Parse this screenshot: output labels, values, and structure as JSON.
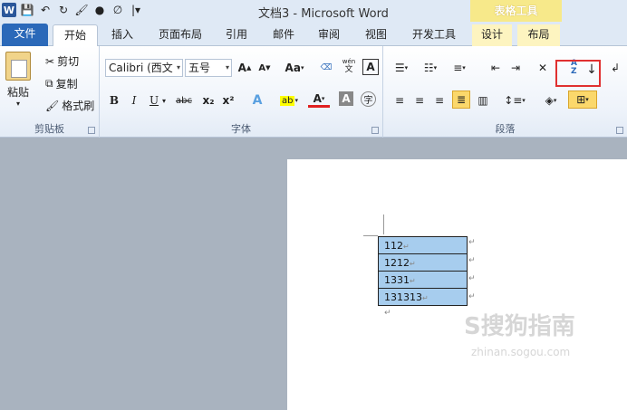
{
  "window": {
    "title": "文档3 - Microsoft Word",
    "context_tools_label": "表格工具"
  },
  "tabs": {
    "file": "文件",
    "home": "开始",
    "insert": "插入",
    "page_layout": "页面布局",
    "references": "引用",
    "mailings": "邮件",
    "review": "审阅",
    "view": "视图",
    "developer": "开发工具",
    "design": "设计",
    "layout": "布局"
  },
  "clipboard": {
    "group_label": "剪贴板",
    "paste": "粘贴",
    "cut": "剪切",
    "copy": "复制",
    "format_painter": "格式刷"
  },
  "font": {
    "group_label": "字体",
    "font_name": "Calibri (西文",
    "font_size": "五号",
    "grow": "A",
    "shrink": "A",
    "change_case": "Aa",
    "bold": "B",
    "italic": "I",
    "underline": "U",
    "strikethrough": "abc",
    "subscript": "x₂",
    "superscript": "x²",
    "font_color": "A",
    "char_shading": "A",
    "enclose": "字",
    "phonetic": "wén"
  },
  "paragraph": {
    "group_label": "段落",
    "sort_label": "A Z"
  },
  "document": {
    "table_rows": [
      "112",
      "1212",
      "1331",
      "131313"
    ],
    "cell_mark": "↵",
    "para_mark": "↵"
  },
  "watermark": {
    "main": "S搜狗指南",
    "sub": "zhinan.sogou.com"
  },
  "colors": {
    "file_tab": "#2b69b9",
    "context_tab": "#f7e98a",
    "cell_highlight": "#a7cdee",
    "callout": "#e03030"
  }
}
